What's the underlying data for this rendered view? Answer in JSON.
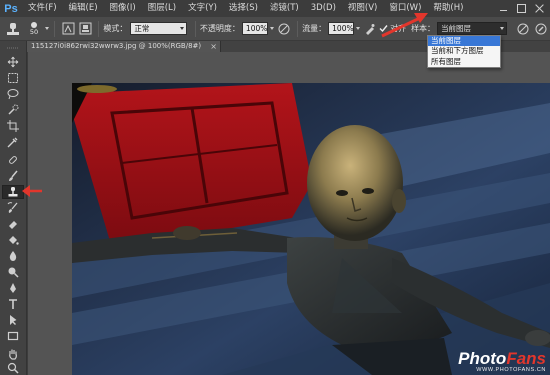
{
  "app": {
    "logo": "Ps"
  },
  "menu": {
    "items": [
      "文件(F)",
      "编辑(E)",
      "图像(I)",
      "图层(L)",
      "文字(Y)",
      "选择(S)",
      "滤镜(T)",
      "3D(D)",
      "视图(V)",
      "窗口(W)",
      "帮助(H)"
    ]
  },
  "options_bar": {
    "brush_size": "50",
    "mode_label": "模式：",
    "mode_value": "正常",
    "opacity_label": "不透明度：",
    "opacity_value": "100%",
    "flow_label": "流量：",
    "flow_value": "100%",
    "align_label": "对齐",
    "align_checked": true,
    "sample_label": "样本：",
    "sample_value": "当前图层"
  },
  "sample_dropdown": {
    "options": [
      "当前图层",
      "当前和下方图层",
      "所有图层"
    ],
    "selected_index": 0
  },
  "document_tab": {
    "title": "115127i0i862rwi32wwrw3.jpg @ 100%(RGB/8#)",
    "close": "×"
  },
  "toolbar": {
    "active_tool": "clone-stamp-tool",
    "active_tool_index": 10
  },
  "watermark": {
    "logo_main": "Photo",
    "logo_accent": "Fans",
    "url": "WWW.PHOTOFANS.CN"
  },
  "colors": {
    "accent": "#e2362c",
    "dropdown_selected": "#3877d6",
    "ps_logo": "#5bb3ff"
  }
}
